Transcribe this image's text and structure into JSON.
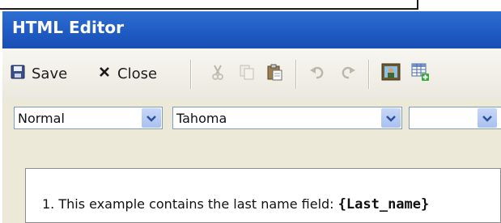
{
  "window": {
    "title": "HTML Editor"
  },
  "toolbar": {
    "save_label": "Save",
    "close_label": "Close",
    "icons": [
      "save-icon",
      "close-icon",
      "cut-icon",
      "copy-icon",
      "paste-icon",
      "undo-icon",
      "redo-icon",
      "insert-image-icon",
      "insert-table-icon"
    ]
  },
  "format_bar": {
    "style_value": "Normal",
    "font_value": "Tahoma",
    "size_value": ""
  },
  "editor": {
    "line_text": "1. This example contains the last name field: ",
    "merge_field": "{Last_name}"
  },
  "colors": {
    "titlebar": "#1f5bc4",
    "title_text": "#ffffff",
    "window_bg": "#ece9d8",
    "combo_border": "#7f9db9",
    "dropdown_button": "#b5caf3"
  }
}
